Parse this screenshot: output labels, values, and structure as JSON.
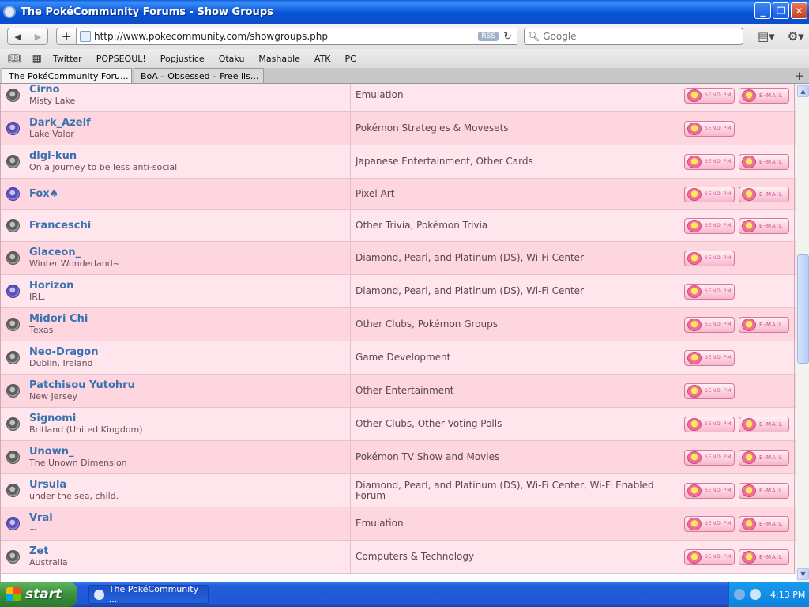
{
  "window": {
    "title": "The PokéCommunity Forums - Show Groups",
    "controls": [
      "_",
      "❐",
      "✕"
    ]
  },
  "toolbar": {
    "url": "http://www.pokecommunity.com/showgroups.php",
    "rss_label": "RSS",
    "search_placeholder": "Google"
  },
  "bookmarks": [
    "Twitter",
    "POPSEOUL!",
    "Popjustice",
    "Otaku",
    "Mashable",
    "ATK",
    "PC"
  ],
  "tabs": [
    {
      "label": "The PokéCommunity Foru...",
      "active": true
    },
    {
      "label": "BoA – Obsessed – Free lis...",
      "active": false
    }
  ],
  "buttons": {
    "send_pm": "SEND PM",
    "email": "E-MAIL"
  },
  "members": [
    {
      "name": "Cirno",
      "title": "Misty Lake",
      "forums": "Emulation",
      "online": false,
      "email": true
    },
    {
      "name": "Dark_Azelf",
      "title": "Lake Valor",
      "forums": "Pokémon Strategies & Movesets",
      "online": true,
      "email": false
    },
    {
      "name": "digi-kun",
      "title": "On a journey to be less anti-social",
      "forums": "Japanese Entertainment, Other Cards",
      "online": false,
      "email": true
    },
    {
      "name": "Fox♠",
      "title": "",
      "forums": "Pixel Art",
      "online": true,
      "email": true
    },
    {
      "name": "Franceschi",
      "title": "",
      "forums": "Other Trivia, Pokémon Trivia",
      "online": false,
      "email": true
    },
    {
      "name": "Glaceon_",
      "title": "Winter Wonderland~",
      "forums": "Diamond, Pearl, and Platinum (DS), Wi-Fi Center",
      "online": false,
      "email": false
    },
    {
      "name": "Horizon",
      "title": "IRL.",
      "forums": "Diamond, Pearl, and Platinum (DS), Wi-Fi Center",
      "online": true,
      "email": false
    },
    {
      "name": "Midori Chi",
      "title": "Texas",
      "forums": "Other Clubs, Pokémon Groups",
      "online": false,
      "email": true
    },
    {
      "name": "Neo-Dragon",
      "title": "Dublin, Ireland",
      "forums": "Game Development",
      "online": false,
      "email": false
    },
    {
      "name": "Patchisou Yutohru",
      "title": "New Jersey",
      "forums": "Other Entertainment",
      "online": false,
      "email": false
    },
    {
      "name": "Signomi",
      "title": "Britland (United Kingdom)",
      "forums": "Other Clubs, Other Voting Polls",
      "online": false,
      "email": true
    },
    {
      "name": "Unown_",
      "title": "The Unown Dimension",
      "forums": "Pokémon TV Show and Movies",
      "online": false,
      "email": true
    },
    {
      "name": "Ursula",
      "title": "under the sea, child.",
      "forums": "Diamond, Pearl, and Platinum (DS), Wi-Fi Center, Wi-Fi Enabled Forum",
      "online": false,
      "email": true
    },
    {
      "name": "Vrai",
      "title": "~",
      "forums": "Emulation",
      "online": true,
      "email": true
    },
    {
      "name": "Zet",
      "title": "Australia",
      "forums": "Computers & Technology",
      "online": false,
      "email": true
    }
  ],
  "taskbar": {
    "start_label": "start",
    "task_label": "The PokéCommunity ...",
    "clock": "4:13 PM"
  }
}
